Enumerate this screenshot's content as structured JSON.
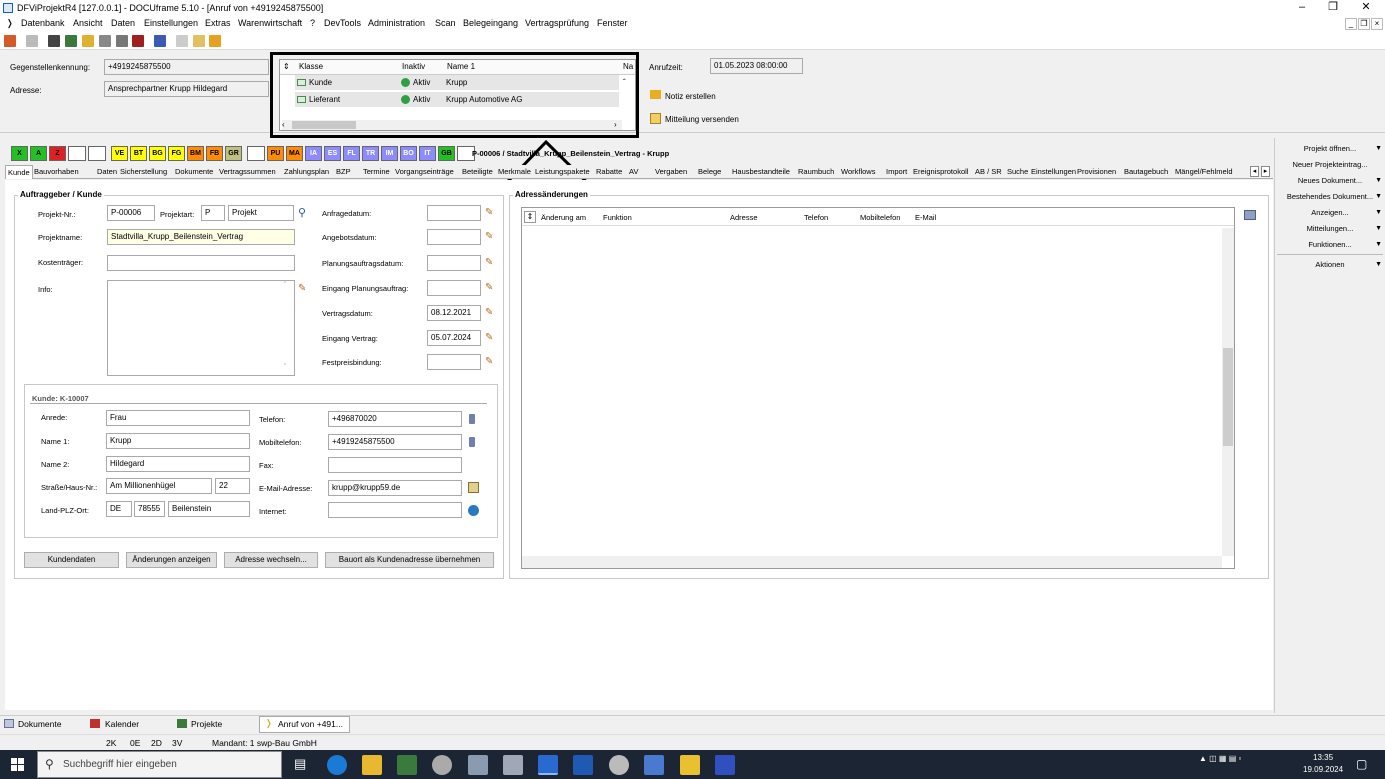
{
  "titlebar": {
    "title": "DFViProjektR4 [127.0.0.1] - DOCUframe 5.10 - [Anruf von +4919245875500]",
    "min_icon": "minimize-icon",
    "max_icon": "restore-icon",
    "close_icon": "close-icon"
  },
  "menubar": {
    "items": [
      "Datenbank",
      "Ansicht",
      "Daten",
      "Einstellungen",
      "Extras",
      "Warenwirtschaft",
      "?",
      "DevTools",
      "Administration",
      "Scan",
      "Belegeingang",
      "Vertragsprüfung",
      "Fenster"
    ]
  },
  "callinfo": {
    "gegenstelle_label": "Gegenstellenkennung:",
    "gegenstelle_value": "+4919245875500",
    "adresse_label": "Adresse:",
    "adresse_value": "Ansprechpartner Krupp Hildegard",
    "anrufzeit_label": "Anrufzeit:",
    "anrufzeit_value": "01.05.2023 08:00:00",
    "notiz_label": "Notiz erstellen",
    "mitteilung_label": "Mitteilung versenden"
  },
  "classgrid": {
    "headers": [
      "Klasse",
      "Inaktiv",
      "Name 1",
      "Na"
    ],
    "rows": [
      {
        "klasse": "Kunde",
        "inaktiv": "Aktiv",
        "name": "Krupp"
      },
      {
        "klasse": "Lieferant",
        "inaktiv": "Aktiv",
        "name": "Krupp Automotive AG"
      }
    ]
  },
  "colorbar": {
    "items": [
      {
        "label": "X",
        "color": "#22c022"
      },
      {
        "label": "A",
        "color": "#22c022"
      },
      {
        "label": "Z",
        "color": "#e02020"
      },
      {
        "label": "",
        "color": "#ffffff"
      },
      {
        "label": "",
        "color": "#ffffff"
      },
      {
        "label": "VE",
        "color": "#ffff00"
      },
      {
        "label": "BT",
        "color": "#ffff00"
      },
      {
        "label": "BG",
        "color": "#ffff00"
      },
      {
        "label": "FG",
        "color": "#ffff00"
      },
      {
        "label": "BM",
        "color": "#ff8c00"
      },
      {
        "label": "FB",
        "color": "#ff8c00"
      },
      {
        "label": "GR",
        "color": "#c0c080"
      },
      {
        "label": "",
        "color": "#ffffff"
      },
      {
        "label": "PU",
        "color": "#ff8c00"
      },
      {
        "label": "MA",
        "color": "#ff8c00"
      },
      {
        "label": "IA",
        "color": "#8c8cff"
      },
      {
        "label": "ES",
        "color": "#8c8cff"
      },
      {
        "label": "FL",
        "color": "#8c8cff"
      },
      {
        "label": "TR",
        "color": "#8c8cff"
      },
      {
        "label": "IM",
        "color": "#8c8cff"
      },
      {
        "label": "BO",
        "color": "#8c8cff"
      },
      {
        "label": "IT",
        "color": "#8c8cff"
      },
      {
        "label": "GB",
        "color": "#22c022"
      },
      {
        "label": "",
        "color": "#ffffff"
      }
    ],
    "project_title": "P-00006 / Stadtvilla_Krupp_Beilenstein_Vertrag - Krupp"
  },
  "tabs": [
    "Kunde",
    "Bauvorhaben",
    "Daten",
    "Sicherstellung",
    "Dokumente",
    "Vertragssummen",
    "Zahlungsplan",
    "BZP",
    "Termine",
    "Vorgangseinträge",
    "Beteiligte",
    "Merkmale",
    "Leistungspakete",
    "Rabatte",
    "AV",
    "Vergaben",
    "Belege",
    "Hausbestandteile",
    "Raumbuch",
    "Workflows",
    "Import",
    "Ereignisprotokoll",
    "AB / SR",
    "Suche",
    "Einstellungen",
    "Provisionen",
    "Bautagebuch",
    "Mängel/Fehlmeld"
  ],
  "auftraggeber": {
    "legend": "Auftraggeber / Kunde",
    "projekt_nr_label": "Projekt-Nr.:",
    "projekt_nr": "P-00006",
    "projektart_label": "Projektart:",
    "projektart_code": "P",
    "projektart": "Projekt",
    "projektname_label": "Projektname:",
    "projektname": "Stadtvilla_Krupp_Beilenstein_Vertrag",
    "kostentraeger_label": "Kostenträger:",
    "info_label": "Info:",
    "dates": [
      {
        "label": "Anfragedatum:",
        "value": ""
      },
      {
        "label": "Angebotsdatum:",
        "value": ""
      },
      {
        "label": "Planungsauftragsdatum:",
        "value": ""
      },
      {
        "label": "Eingang Planungsauftrag:",
        "value": ""
      },
      {
        "label": "Vertragsdatum:",
        "value": "08.12.2021"
      },
      {
        "label": "Eingang Vertrag:",
        "value": "05.07.2024"
      },
      {
        "label": "Festpreisbindung:",
        "value": ""
      }
    ]
  },
  "kunde": {
    "legend": "Kunde: K-10007",
    "anrede_label": "Anrede:",
    "anrede": "Frau",
    "name1_label": "Name 1:",
    "name1": "Krupp",
    "name2_label": "Name 2:",
    "name2": "Hildegard",
    "strasse_label": "Straße/Haus-Nr.:",
    "strasse": "Am Millionenhügel",
    "hausnr": "22",
    "ort_label": "Land-PLZ-Ort:",
    "land": "DE",
    "plz": "78555",
    "ort": "Beilenstein",
    "telefon_label": "Telefon:",
    "telefon": "+496870020",
    "mobil_label": "Mobiltelefon:",
    "mobil": "+4919245875500",
    "fax_label": "Fax:",
    "fax": "",
    "email_label": "E-Mail-Adresse:",
    "email": "krupp@krupp59.de",
    "internet_label": "Internet:",
    "internet": ""
  },
  "buttons": {
    "kundendaten": "Kundendaten",
    "aenderungen": "Änderungen anzeigen",
    "adresse_wechseln": "Adresse wechseln...",
    "bauort": "Bauort als Kundenadresse übernehmen"
  },
  "adressaenderungen": {
    "legend": "Adressänderungen",
    "headers": [
      "Änderung am",
      "Funktion",
      "Adresse",
      "Telefon",
      "Mobiltelefon",
      "E-Mail"
    ]
  },
  "rightpanel": {
    "items": [
      {
        "label": "Projekt öffnen...",
        "arrow": true
      },
      {
        "label": "Neuer Projekteintrag...",
        "arrow": false
      },
      {
        "label": "Neues Dokument...",
        "arrow": true
      },
      {
        "label": "Bestehendes Dokument...",
        "arrow": true
      },
      {
        "label": "Anzeigen...",
        "arrow": true
      },
      {
        "label": "Mitteilungen...",
        "arrow": true
      },
      {
        "label": "Funktionen...",
        "arrow": true
      },
      {
        "label": "Aktionen",
        "arrow": true
      }
    ]
  },
  "bottomtabs": [
    "Dokumente",
    "Kalender",
    "Projekte",
    "Anruf von +491..."
  ],
  "statusbar": [
    "2K",
    "0E",
    "2D",
    "3V",
    "Mandant: 1 swp-Bau GmbH"
  ],
  "taskbar": {
    "search_placeholder": "Suchbegriff hier eingeben",
    "time": "13:35",
    "date": "19.09.2024"
  }
}
